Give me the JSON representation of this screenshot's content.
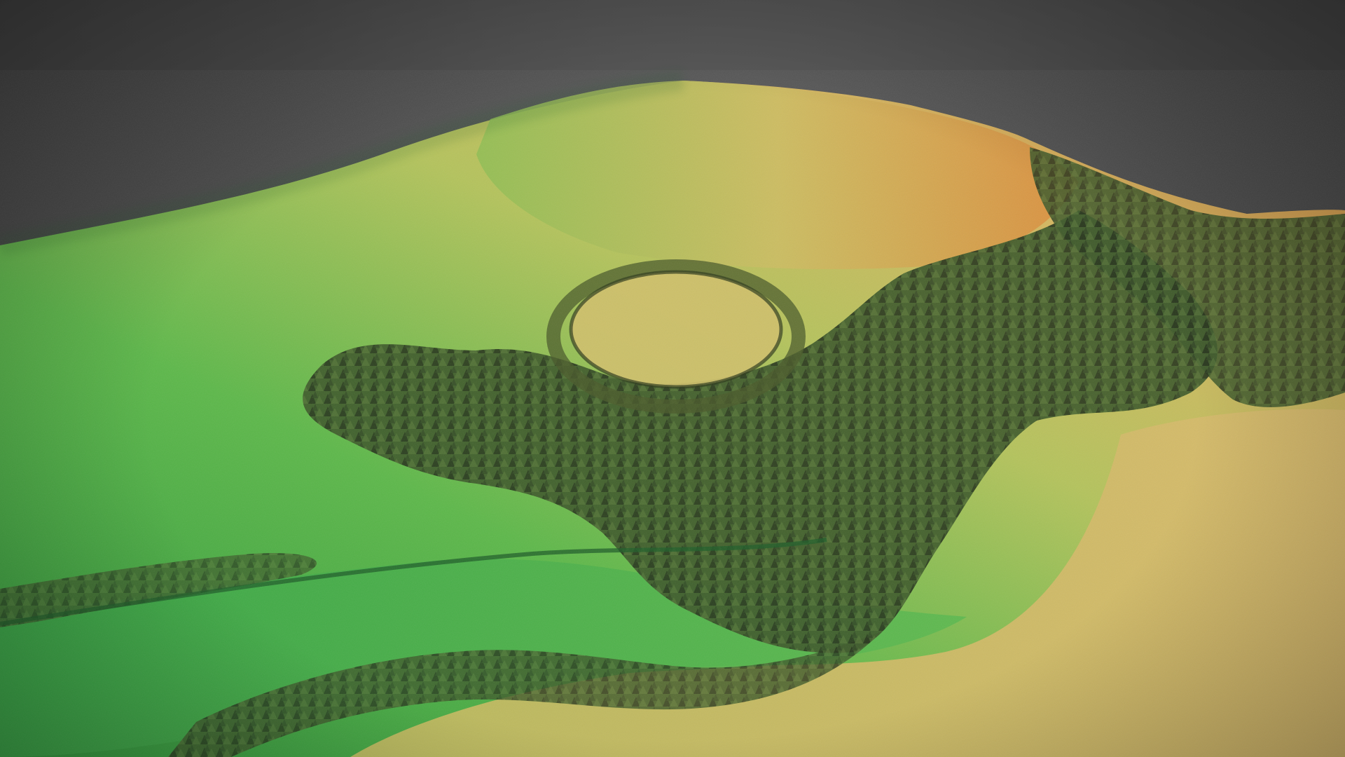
{
  "scene": {
    "type": "3d-lidar-terrain-render",
    "background_color": "#4a4a4a",
    "elevation_palette": {
      "low": "#2f8f3a",
      "mid_low": "#5fb84a",
      "mid": "#a9c35a",
      "mid_high": "#d2b963",
      "high": "#d98a3c"
    },
    "features": [
      "hill-summit",
      "circular-earthwork-enclosure",
      "wooded-slope",
      "linear-track",
      "valley-floor",
      "lower-plateau"
    ]
  }
}
